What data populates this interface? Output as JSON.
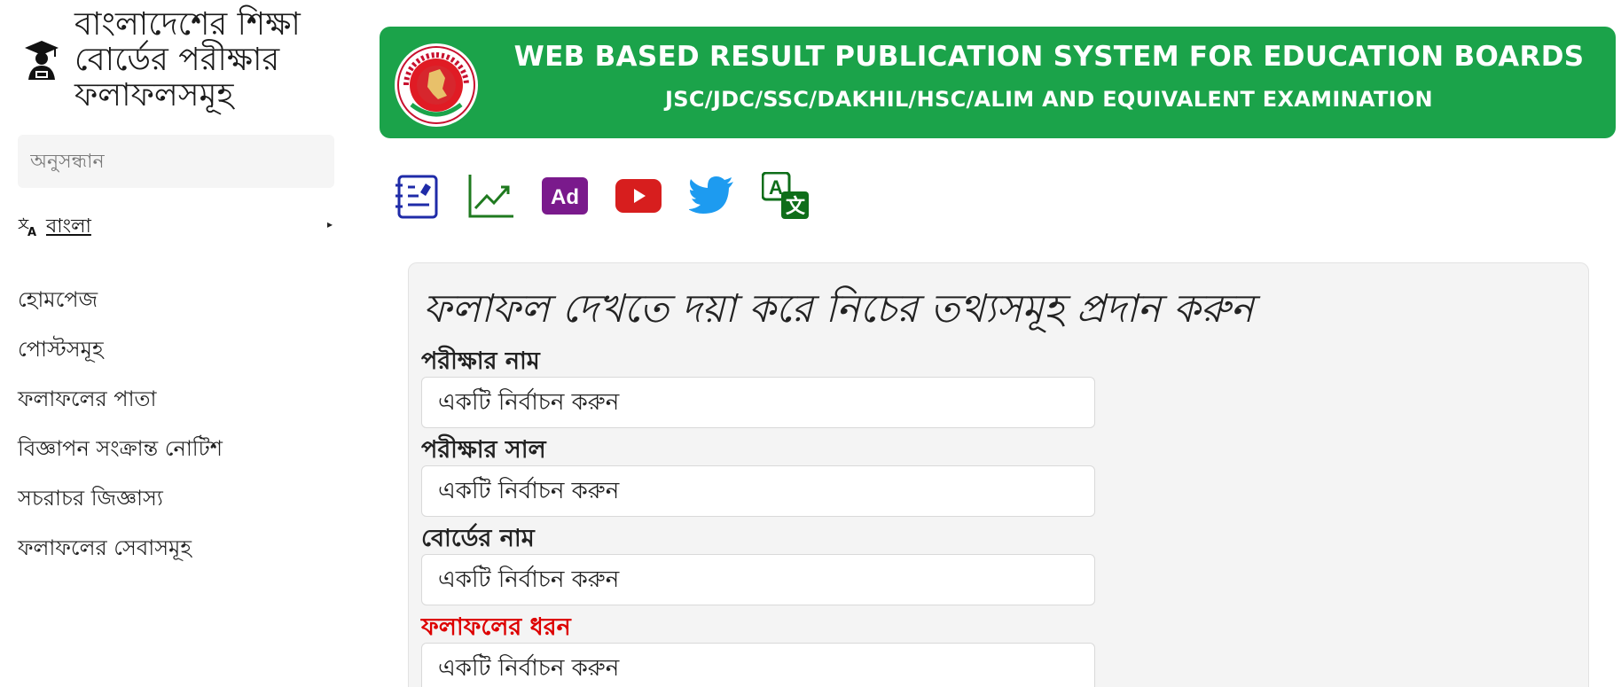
{
  "sidebar": {
    "brand_title": "বাংলাদেশের শিক্ষা বোর্ডের পরীক্ষার ফলাফলসমূহ",
    "brand_icon": "graduate-icon",
    "search_placeholder": "অনুসন্ধান",
    "language": {
      "label": "বাংলা",
      "icon": "translate-icon",
      "caret": "▸"
    },
    "nav": [
      {
        "label": "হোমপেজ"
      },
      {
        "label": "পোস্টসমূহ"
      },
      {
        "label": "ফলাফলের পাতা"
      },
      {
        "label": "বিজ্ঞাপন সংক্রান্ত নোটিশ"
      },
      {
        "label": "সচরাচর জিজ্ঞাস্য"
      },
      {
        "label": "ফলাফলের সেবাসমূহ"
      }
    ]
  },
  "banner": {
    "title": "WEB BASED RESULT PUBLICATION SYSTEM FOR EDUCATION BOARDS",
    "subtitle": "JSC/JDC/SSC/DAKHIL/HSC/ALIM AND EQUIVALENT EXAMINATION",
    "color": "#1ba34a",
    "emblem_icon": "government-seal-icon"
  },
  "toolbar": {
    "icons": [
      "notes-icon",
      "chart-icon",
      "ad-icon",
      "youtube-icon",
      "twitter-icon",
      "translate-icon"
    ],
    "ad_label": "Ad"
  },
  "form": {
    "heading": "ফলাফল দেখতে দয়া করে নিচের তথ্যসমূহ প্রদান করুন",
    "fields": [
      {
        "label": "পরীক্ষার নাম",
        "value": "একটি নির্বাচন করুন"
      },
      {
        "label": "পরীক্ষার সাল",
        "value": "একটি নির্বাচন করুন"
      },
      {
        "label": "বোর্ডের নাম",
        "value": "একটি নির্বাচন করুন"
      },
      {
        "label": "ফলাফলের ধরন",
        "value": "একটি নির্বাচন করুন",
        "label_color": "#dd0000"
      }
    ]
  }
}
